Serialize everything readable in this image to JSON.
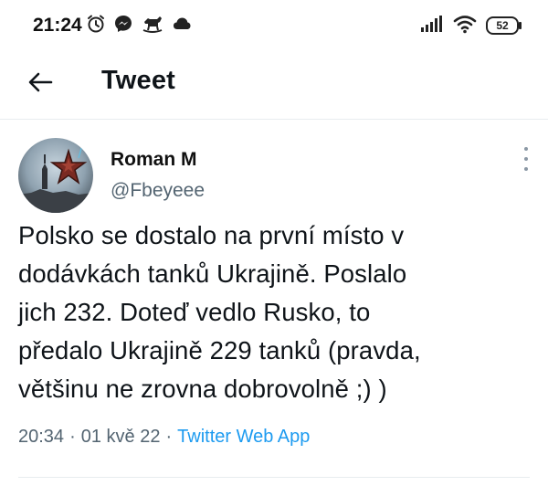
{
  "status_bar": {
    "time": "21:24",
    "battery": "52",
    "left_icons": [
      "alarm-icon",
      "messenger-icon",
      "rocking-horse-icon",
      "cloud-icon"
    ],
    "right_icons": [
      "signal-icon",
      "wifi-icon",
      "battery-icon"
    ]
  },
  "header": {
    "title": "Tweet",
    "back_icon": "arrow-left-icon"
  },
  "tweet": {
    "author": {
      "display_name": "Roman M",
      "handle": "@Fbeyeee"
    },
    "text_lines": [
      "Polsko se dostalo na první místo v",
      "dodávkách tanků Ukrajině. Poslalo",
      "jich 232. Doteď vedlo Rusko, to",
      "předalo Ukrajině 229 tanků (pravda,",
      "většinu ne zrovna dobrovolně ;) )"
    ],
    "time": "20:34",
    "date": "01 kvě 22",
    "separator": "·",
    "source": "Twitter Web App"
  },
  "colors": {
    "text": "#0f1419",
    "secondary": "#536471",
    "link": "#1d9bf0",
    "divider": "#e8ecef"
  }
}
